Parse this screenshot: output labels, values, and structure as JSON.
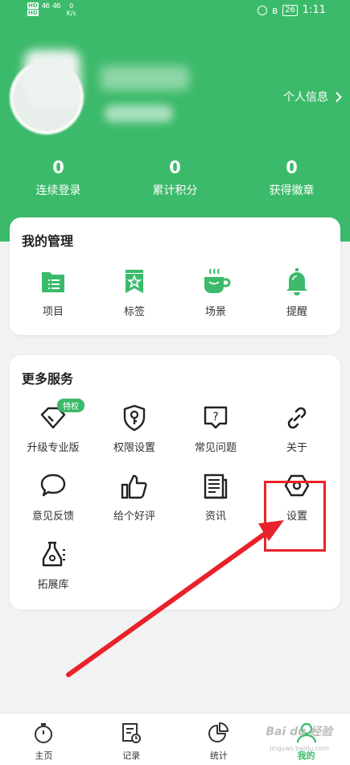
{
  "status_bar": {
    "hd1": "HD",
    "hd2": "HD",
    "signal1": "46",
    "signal2": "46",
    "net_speed": "0",
    "net_unit": "K/s",
    "battery": "26",
    "time": "1:11"
  },
  "profile": {
    "link_label": "个人信息"
  },
  "stats": [
    {
      "value": "0",
      "label": "连续登录"
    },
    {
      "value": "0",
      "label": "累计积分"
    },
    {
      "value": "0",
      "label": "获得徽章"
    }
  ],
  "management": {
    "title": "我的管理",
    "items": [
      {
        "label": "项目",
        "icon": "folder-icon"
      },
      {
        "label": "标签",
        "icon": "tag-icon"
      },
      {
        "label": "场景",
        "icon": "coffee-icon"
      },
      {
        "label": "提醒",
        "icon": "bell-icon"
      }
    ]
  },
  "services": {
    "title": "更多服务",
    "badge": "特权",
    "items": [
      {
        "label": "升级专业版",
        "icon": "diamond-icon"
      },
      {
        "label": "权限设置",
        "icon": "shield-key-icon"
      },
      {
        "label": "常见问题",
        "icon": "question-icon"
      },
      {
        "label": "关于",
        "icon": "link-icon"
      },
      {
        "label": "意见反馈",
        "icon": "chat-icon"
      },
      {
        "label": "给个好评",
        "icon": "thumbs-up-icon"
      },
      {
        "label": "资讯",
        "icon": "news-icon"
      },
      {
        "label": "设置",
        "icon": "settings-hex-icon"
      },
      {
        "label": "拓展库",
        "icon": "flask-icon"
      }
    ]
  },
  "tabbar": [
    {
      "label": "主页",
      "icon": "stopwatch-icon"
    },
    {
      "label": "记录",
      "icon": "record-icon"
    },
    {
      "label": "统计",
      "icon": "pie-chart-icon"
    },
    {
      "label": "我的",
      "icon": "user-icon",
      "active": true
    }
  ],
  "watermark": {
    "text": "Bai du 经验",
    "sub": "jingyan.baidu.com"
  },
  "colors": {
    "brand": "#3cba6b",
    "annotation": "#e8222a"
  }
}
